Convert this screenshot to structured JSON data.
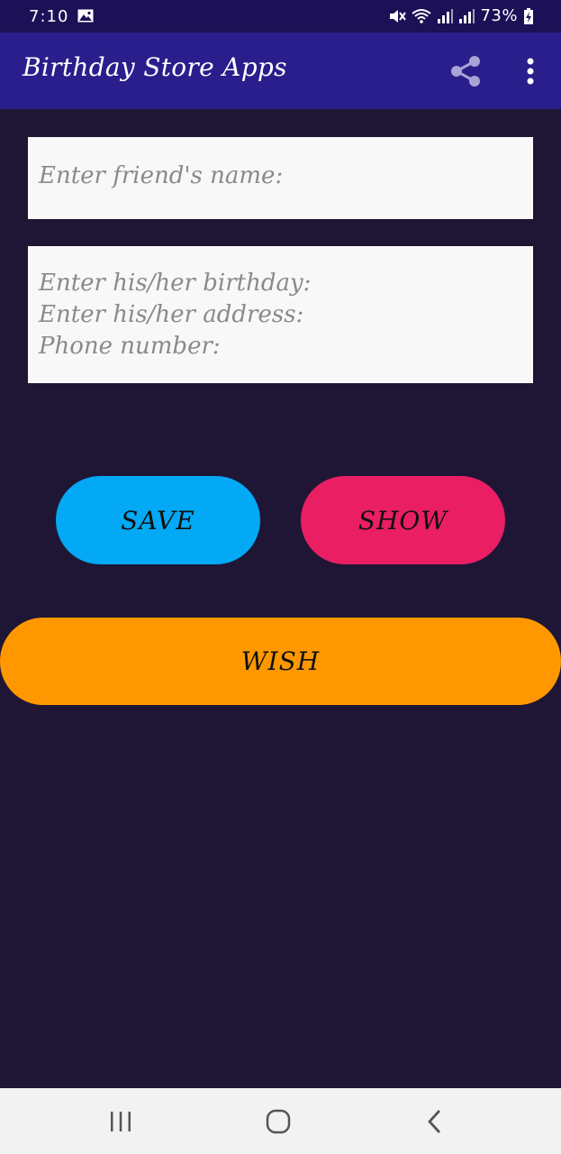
{
  "status_bar": {
    "time": "7:10",
    "battery": "73%",
    "icons": [
      "gallery-icon",
      "mute-icon",
      "wifi-icon",
      "signal-icon",
      "signal-icon",
      "battery-icon"
    ]
  },
  "app_bar": {
    "title": "Birthday Store Apps",
    "actions": [
      "share-icon",
      "more-vert-icon"
    ]
  },
  "form": {
    "name_hint": "Enter friend's name:",
    "details_lines": [
      "Enter his/her birthday:",
      "Enter his/her address:",
      "Phone number:"
    ]
  },
  "buttons": {
    "save": "SAVE",
    "show": "SHOW",
    "wish": "WISH"
  },
  "nav_bar": {
    "icons": [
      "recents-icon",
      "home-icon",
      "back-icon"
    ]
  },
  "colors": {
    "status_bar": "#1c1056",
    "app_bar": "#2a1e8c",
    "background": "#1f1635",
    "field": "#f8f8f8",
    "save": "#03a9f4",
    "show": "#e91e63",
    "wish": "#ff9800",
    "nav_bar": "#f2f2f2"
  }
}
